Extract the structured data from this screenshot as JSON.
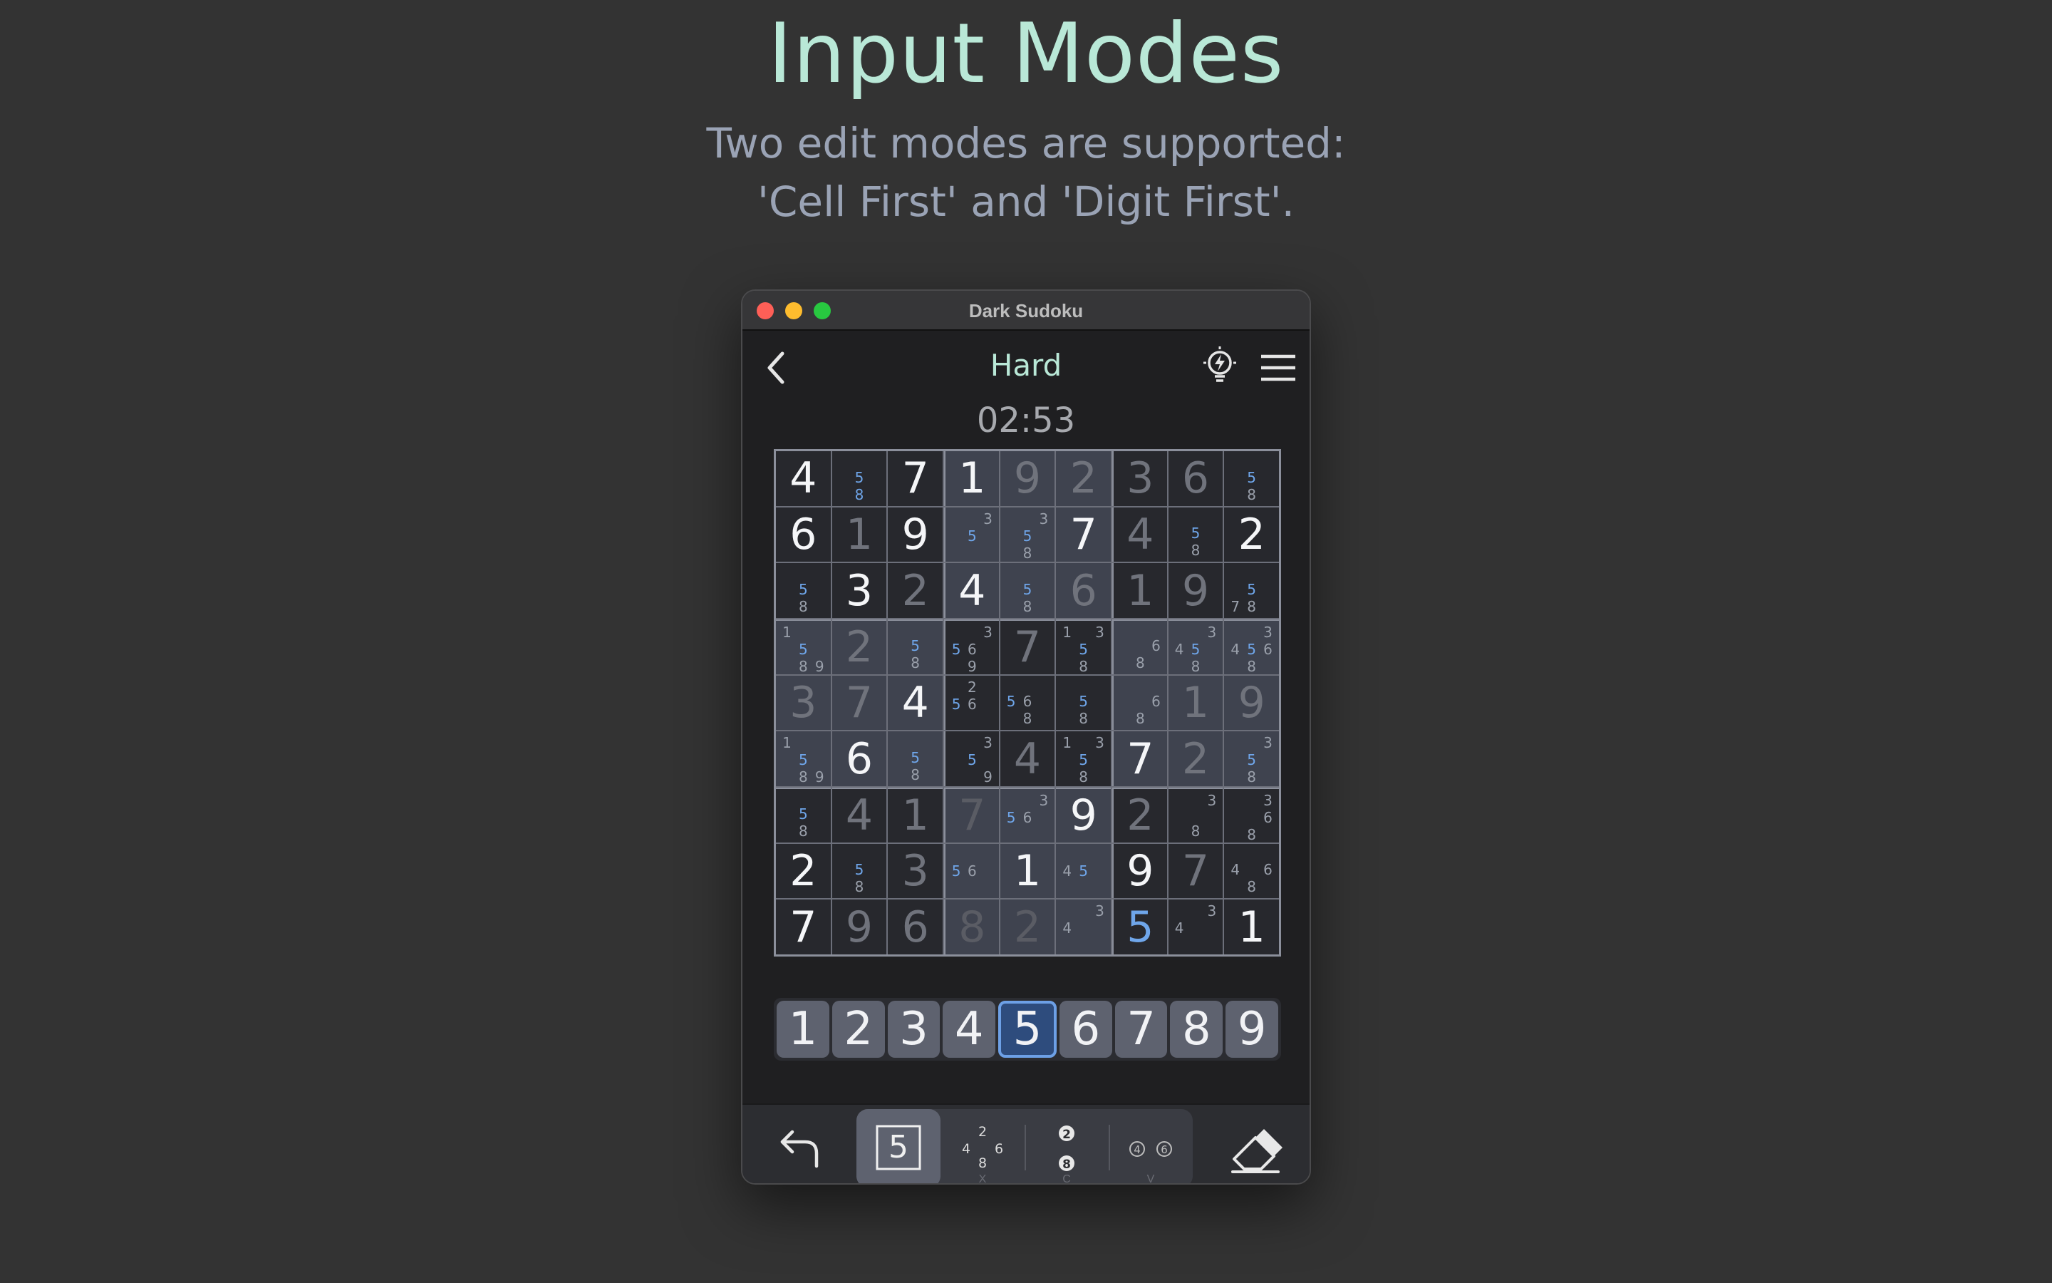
{
  "hero": {
    "title": "Input Modes",
    "subtitle_line1": "Two edit modes are supported:",
    "subtitle_line2": "'Cell First' and 'Digit First'."
  },
  "window": {
    "title": "Dark Sudoku"
  },
  "header": {
    "difficulty": "Hard",
    "back_icon": "chevron-left-icon",
    "hint_icon": "lightbulb-icon",
    "menu_icon": "hamburger-menu-icon"
  },
  "timer": "02:53",
  "colors": {
    "accent": "#b9e8d7",
    "selected": "#6fa6ea",
    "background": "#333333"
  },
  "board": {
    "rows": [
      [
        {
          "v": "4",
          "k": "given"
        },
        {
          "n": [
            "",
            "",
            "",
            "",
            "5",
            "",
            "",
            "8",
            ""
          ],
          "h": [
            4,
            7
          ]
        },
        {
          "v": "7",
          "k": "given"
        },
        {
          "v": "1",
          "k": "given"
        },
        {
          "v": "9",
          "k": "filled"
        },
        {
          "v": "2",
          "k": "filled"
        },
        {
          "v": "3",
          "k": "filled"
        },
        {
          "v": "6",
          "k": "filled"
        },
        {
          "n": [
            "",
            "",
            "",
            "",
            "5",
            "",
            "",
            "8",
            ""
          ],
          "h": [
            4
          ]
        }
      ],
      [
        {
          "v": "6",
          "k": "given"
        },
        {
          "v": "1",
          "k": "filled"
        },
        {
          "v": "9",
          "k": "given"
        },
        {
          "n": [
            "",
            "",
            "3",
            "",
            "5",
            "",
            "",
            "",
            ""
          ],
          "h": [
            4
          ]
        },
        {
          "n": [
            "",
            "",
            "3",
            "",
            "5",
            "",
            "",
            "8",
            ""
          ],
          "h": [
            4
          ]
        },
        {
          "v": "7",
          "k": "given"
        },
        {
          "v": "4",
          "k": "filled"
        },
        {
          "n": [
            "",
            "",
            "",
            "",
            "5",
            "",
            "",
            "8",
            ""
          ],
          "h": [
            4
          ]
        },
        {
          "v": "2",
          "k": "given"
        }
      ],
      [
        {
          "n": [
            "",
            "",
            "",
            "",
            "5",
            "",
            "",
            "8",
            ""
          ],
          "h": [
            4
          ]
        },
        {
          "v": "3",
          "k": "given"
        },
        {
          "v": "2",
          "k": "filled"
        },
        {
          "v": "4",
          "k": "given"
        },
        {
          "n": [
            "",
            "",
            "",
            "",
            "5",
            "",
            "",
            "8",
            ""
          ],
          "h": [
            4
          ]
        },
        {
          "v": "6",
          "k": "filled"
        },
        {
          "v": "1",
          "k": "filled"
        },
        {
          "v": "9",
          "k": "filled"
        },
        {
          "n": [
            "",
            "",
            "",
            "",
            "5",
            "",
            "7",
            "8",
            ""
          ],
          "h": [
            4
          ]
        }
      ],
      [
        {
          "n": [
            "1",
            "",
            "",
            "",
            "5",
            "",
            "",
            "8",
            "9"
          ],
          "h": [
            4
          ]
        },
        {
          "v": "2",
          "k": "filled"
        },
        {
          "n": [
            "",
            "",
            "",
            "",
            "5",
            "",
            "",
            "8",
            ""
          ],
          "h": [
            4
          ]
        },
        {
          "n": [
            "",
            "",
            "3",
            "5",
            "6",
            "",
            "",
            "9",
            ""
          ],
          "h": [
            3
          ]
        },
        {
          "v": "7",
          "k": "filled"
        },
        {
          "n": [
            "1",
            "",
            "3",
            "",
            "5",
            "",
            "",
            "8",
            ""
          ],
          "h": [
            4
          ]
        },
        {
          "n": [
            "",
            "",
            "",
            "",
            "",
            "6",
            "",
            "8",
            ""
          ],
          "h": []
        },
        {
          "n": [
            "",
            "",
            "3",
            "4",
            "5",
            "",
            "",
            "8",
            ""
          ],
          "h": [
            4
          ]
        },
        {
          "n": [
            "",
            "",
            "3",
            "4",
            "5",
            "6",
            "",
            "8",
            ""
          ],
          "h": [
            4
          ]
        }
      ],
      [
        {
          "v": "3",
          "k": "filled"
        },
        {
          "v": "7",
          "k": "filled"
        },
        {
          "v": "4",
          "k": "given"
        },
        {
          "n": [
            "",
            "2",
            "",
            "5",
            "6",
            "",
            "",
            "",
            ""
          ],
          "h": [
            3
          ]
        },
        {
          "n": [
            "",
            "",
            "",
            "5",
            "6",
            "",
            "",
            "8",
            ""
          ],
          "h": [
            3
          ]
        },
        {
          "n": [
            "",
            "",
            "",
            "",
            "5",
            "",
            "",
            "8",
            ""
          ],
          "h": [
            4
          ]
        },
        {
          "n": [
            "",
            "",
            "",
            "",
            "",
            "6",
            "",
            "8",
            ""
          ],
          "h": []
        },
        {
          "v": "1",
          "k": "filled"
        },
        {
          "v": "9",
          "k": "filled"
        }
      ],
      [
        {
          "n": [
            "1",
            "",
            "",
            "",
            "5",
            "",
            "",
            "8",
            "9"
          ],
          "h": [
            4
          ]
        },
        {
          "v": "6",
          "k": "given"
        },
        {
          "n": [
            "",
            "",
            "",
            "",
            "5",
            "",
            "",
            "8",
            ""
          ],
          "h": [
            4
          ]
        },
        {
          "n": [
            "",
            "",
            "3",
            "",
            "5",
            "",
            "",
            "",
            "9"
          ],
          "h": [
            4
          ]
        },
        {
          "v": "4",
          "k": "filled"
        },
        {
          "n": [
            "1",
            "",
            "3",
            "",
            "5",
            "",
            "",
            "8",
            ""
          ],
          "h": [
            4
          ]
        },
        {
          "v": "7",
          "k": "given"
        },
        {
          "v": "2",
          "k": "filled"
        },
        {
          "n": [
            "",
            "",
            "3",
            "",
            "5",
            "",
            "",
            "8",
            ""
          ],
          "h": [
            4
          ]
        }
      ],
      [
        {
          "n": [
            "",
            "",
            "",
            "",
            "5",
            "",
            "",
            "8",
            ""
          ],
          "h": [
            4
          ]
        },
        {
          "v": "4",
          "k": "filled"
        },
        {
          "v": "1",
          "k": "filled"
        },
        {
          "v": "7",
          "k": "dark"
        },
        {
          "n": [
            "",
            "",
            "3",
            "5",
            "6",
            "",
            "",
            "",
            ""
          ],
          "h": [
            3
          ]
        },
        {
          "v": "9",
          "k": "given"
        },
        {
          "v": "2",
          "k": "filled"
        },
        {
          "n": [
            "",
            "",
            "3",
            "",
            "",
            "",
            "",
            "8",
            ""
          ],
          "h": []
        },
        {
          "n": [
            "",
            "",
            "3",
            "",
            "",
            "6",
            "",
            "8",
            ""
          ],
          "h": []
        }
      ],
      [
        {
          "v": "2",
          "k": "given"
        },
        {
          "n": [
            "",
            "",
            "",
            "",
            "5",
            "",
            "",
            "8",
            ""
          ],
          "h": [
            4
          ]
        },
        {
          "v": "3",
          "k": "filled"
        },
        {
          "n": [
            "",
            "",
            "",
            "5",
            "6",
            "",
            "",
            "",
            ""
          ],
          "h": [
            3
          ]
        },
        {
          "v": "1",
          "k": "given"
        },
        {
          "n": [
            "",
            "",
            "",
            "4",
            "5",
            "",
            "",
            "",
            ""
          ],
          "h": [
            4
          ]
        },
        {
          "v": "9",
          "k": "given"
        },
        {
          "v": "7",
          "k": "filled"
        },
        {
          "n": [
            "",
            "",
            "",
            "4",
            "",
            "6",
            "",
            "8",
            ""
          ],
          "h": []
        }
      ],
      [
        {
          "v": "7",
          "k": "given"
        },
        {
          "v": "9",
          "k": "filled"
        },
        {
          "v": "6",
          "k": "filled"
        },
        {
          "v": "8",
          "k": "dark"
        },
        {
          "v": "2",
          "k": "dark"
        },
        {
          "n": [
            "",
            "",
            "3",
            "4",
            "",
            "",
            "",
            "",
            ""
          ],
          "h": []
        },
        {
          "v": "5",
          "k": "accent"
        },
        {
          "n": [
            "",
            "",
            "3",
            "4",
            "",
            "",
            "",
            "",
            ""
          ],
          "h": []
        },
        {
          "v": "1",
          "k": "given"
        }
      ]
    ]
  },
  "digit_bar": {
    "digits": [
      "1",
      "2",
      "3",
      "4",
      "5",
      "6",
      "7",
      "8",
      "9"
    ],
    "selected": "5"
  },
  "toolbar": {
    "undo_icon": "undo-icon",
    "modes": [
      {
        "label": "5",
        "key": "",
        "icon": "cell-first-mode-icon"
      },
      {
        "label": "2 4 6 8",
        "key": "X",
        "icon": "pencil-notes-mode-icon"
      },
      {
        "label": "2 8",
        "key": "C",
        "icon": "center-notes-mode-icon"
      },
      {
        "label": "4 6",
        "key": "V",
        "icon": "color-notes-mode-icon"
      }
    ],
    "eraser_icon": "eraser-icon"
  }
}
